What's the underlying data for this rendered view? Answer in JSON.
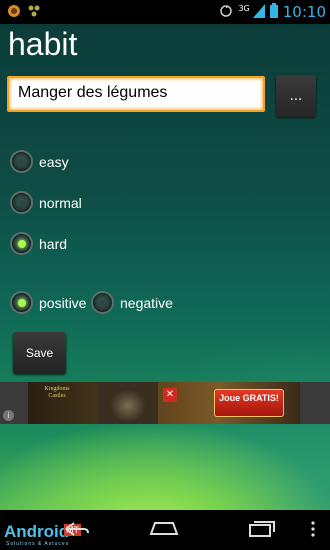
{
  "status_bar": {
    "time": "10:10",
    "network": "3G",
    "icons": [
      "app-notification-icon",
      "bug-notification-icon",
      "sync-icon",
      "signal-icon",
      "battery-icon"
    ]
  },
  "screen": {
    "title": "habit",
    "habit_name_value": "Manger des légumes",
    "browse_button_label": "..."
  },
  "difficulty": {
    "options": [
      {
        "label": "easy",
        "checked": false
      },
      {
        "label": "normal",
        "checked": false
      },
      {
        "label": "hard",
        "checked": true
      }
    ]
  },
  "polarity": {
    "options": [
      {
        "label": "positive",
        "checked": true
      },
      {
        "label": "negative",
        "checked": false
      }
    ]
  },
  "save_label": "Save",
  "ad": {
    "logo_text": "Kingdoms Castles",
    "cta": "Joue GRATIS!"
  },
  "nav_bar": {
    "watermark": "Android",
    "watermark_badge": "MT",
    "watermark_sub": "Solutions & Astuces"
  },
  "colors": {
    "accent_clock": "#33b5e5",
    "text_field_border": "#f6a227",
    "radio_checked": "#a5ff4c"
  }
}
